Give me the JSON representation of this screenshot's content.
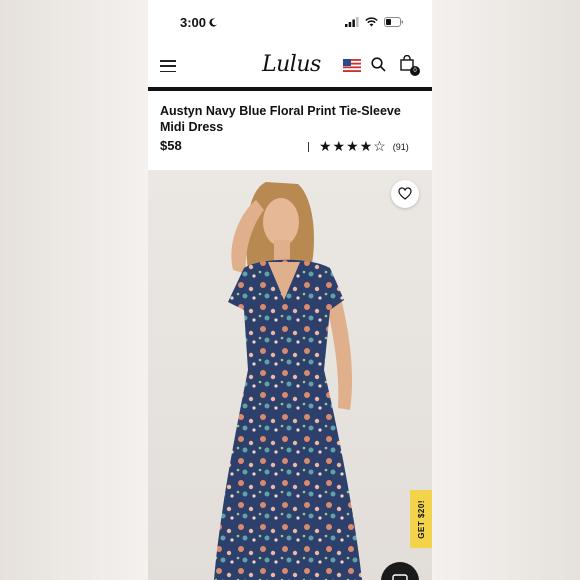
{
  "status_bar": {
    "time": "3:00"
  },
  "header": {
    "logo": "Lulus",
    "bag_count": "0"
  },
  "product": {
    "title": "Austyn Navy Blue Floral Print Tie-Sleeve Midi Dress",
    "price": "$58",
    "rating": {
      "stars": 4,
      "max_stars": 5,
      "review_count": "(91)"
    }
  },
  "promo": {
    "label": "GET $20!"
  },
  "colors": {
    "accent": "#f3d34a",
    "dress_navy": "#2d3f6b",
    "text": "#111111"
  },
  "icons": {
    "menu": "hamburger-menu-icon",
    "flag": "us-flag-icon",
    "search": "search-icon",
    "bag": "shopping-bag-icon",
    "wishlist": "heart-icon",
    "chat": "chat-icon"
  }
}
